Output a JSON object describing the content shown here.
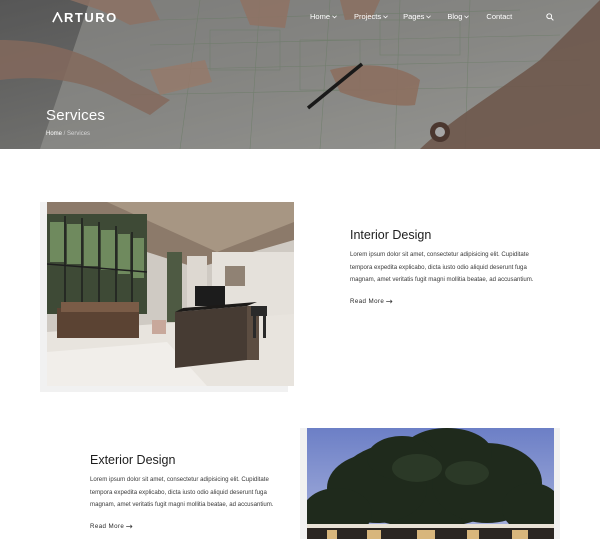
{
  "brand": {
    "name": "RTURO"
  },
  "nav": {
    "items": [
      {
        "label": "Home"
      },
      {
        "label": "Projects"
      },
      {
        "label": "Pages"
      },
      {
        "label": "Blog"
      },
      {
        "label": "Contact"
      }
    ]
  },
  "hero": {
    "title": "Services",
    "breadcrumb": {
      "home": "Home",
      "separator": " / ",
      "current": "Services"
    }
  },
  "services": [
    {
      "title": "Interior Design",
      "text": "Lorem ipsum dolor sit amet, consectetur adipisicing elit. Cupiditate tempora expedita explicabo, dicta iusto odio aliquid deserunt fuga magnam, amet veritatis fugit magni mollitia beatae, ad accusantium.",
      "read_more": "Read More"
    },
    {
      "title": "Exterior Design",
      "text": "Lorem ipsum dolor sit amet, consectetur adipisicing elit. Cupiditate tempora expedita explicabo, dicta iusto odio aliquid deserunt fuga magnam, amet veritatis fugit magni mollitia beatae, ad accusantium.",
      "read_more": "Read More"
    }
  ],
  "icons": {
    "logo": "logo-a-mark-icon",
    "dropdown": "chevron-down-icon",
    "search": "search-icon",
    "read_more": "arrow-right-icon"
  },
  "colors": {
    "hero_overlay": "#3a3a3a",
    "text_dark": "#1d1d1d",
    "text_body": "#3a3a3a",
    "background": "#ffffff",
    "sky": "#8c9bd6"
  }
}
